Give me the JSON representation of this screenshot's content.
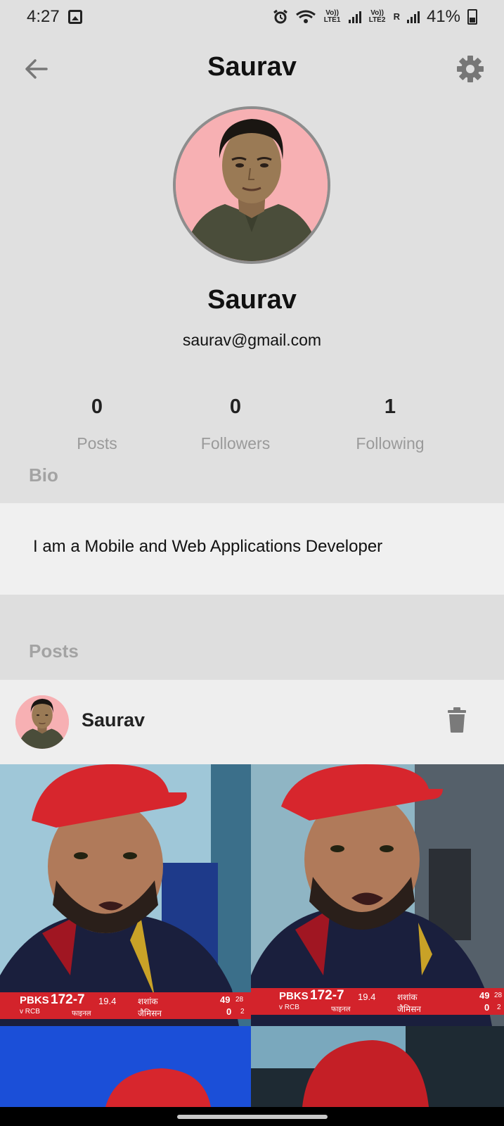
{
  "status_bar": {
    "time": "4:27",
    "battery": "41%",
    "sim1_label": "Vo)) LTE1",
    "sim2_label": "Vo)) LTE2",
    "roaming": "R"
  },
  "app_bar": {
    "title": "Saurav"
  },
  "profile": {
    "name": "Saurav",
    "email": "saurav@gmail.com"
  },
  "stats": [
    {
      "value": "0",
      "label": "Posts"
    },
    {
      "value": "0",
      "label": "Followers"
    },
    {
      "value": "1",
      "label": "Following"
    }
  ],
  "bio": {
    "label": "Bio",
    "text": "I am a Mobile and Web Applications Developer"
  },
  "posts": {
    "label": "Posts",
    "items": [
      {
        "author": "Saurav",
        "scoreboard": {
          "team": "PBKS",
          "score": "172-7",
          "overs": "19.4",
          "opponent": "v RCB",
          "stage": "फाइनल",
          "batter1": "शशांक",
          "batter2": "जैमिसन",
          "b1_runs": "49",
          "b1_balls": "28",
          "b2_runs": "0",
          "b2_balls": "2"
        }
      }
    ]
  },
  "colors": {
    "background": "#e0e0e0",
    "card": "#eeeeee",
    "muted_label": "#a3a3a3",
    "avatar_bg": "#f7b0b3"
  }
}
